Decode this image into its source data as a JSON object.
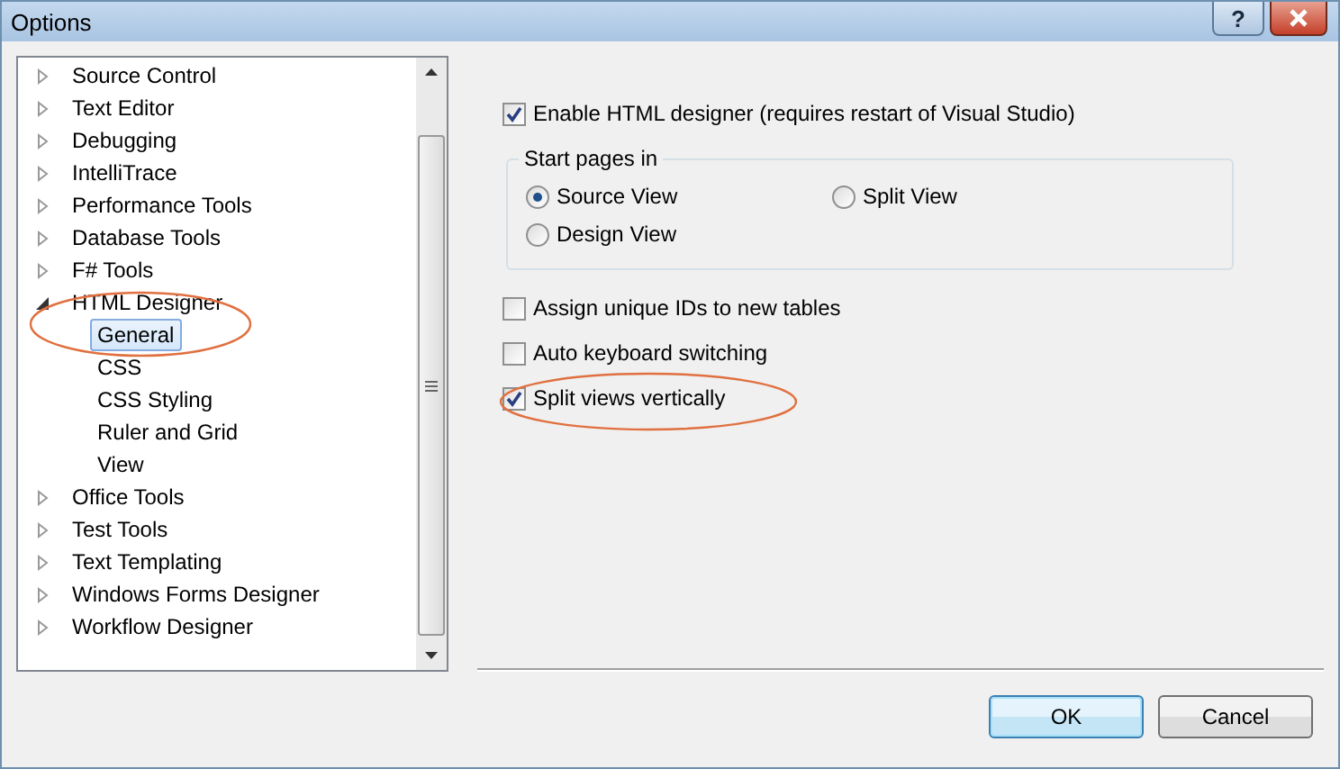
{
  "window": {
    "title": "Options",
    "help_button": "?"
  },
  "tree": [
    {
      "label": "Source Control",
      "expanded": false
    },
    {
      "label": "Text Editor",
      "expanded": false
    },
    {
      "label": "Debugging",
      "expanded": false
    },
    {
      "label": "IntelliTrace",
      "expanded": false
    },
    {
      "label": "Performance Tools",
      "expanded": false
    },
    {
      "label": "Database Tools",
      "expanded": false
    },
    {
      "label": "F# Tools",
      "expanded": false
    },
    {
      "label": "HTML Designer",
      "expanded": true,
      "children": [
        {
          "label": "General",
          "selected": true
        },
        {
          "label": "CSS",
          "selected": false
        },
        {
          "label": "CSS Styling",
          "selected": false
        },
        {
          "label": "Ruler and Grid",
          "selected": false
        },
        {
          "label": "View",
          "selected": false
        }
      ]
    },
    {
      "label": "Office Tools",
      "expanded": false
    },
    {
      "label": "Test Tools",
      "expanded": false
    },
    {
      "label": "Text Templating",
      "expanded": false
    },
    {
      "label": "Windows Forms Designer",
      "expanded": false
    },
    {
      "label": "Workflow Designer",
      "expanded": false
    }
  ],
  "enable_designer": {
    "label": "Enable HTML designer (requires restart of Visual Studio)",
    "checked": true
  },
  "start_pages": {
    "legend": "Start pages in",
    "options": [
      {
        "label": "Source View",
        "selected": true
      },
      {
        "label": "Split View",
        "selected": false
      },
      {
        "label": "Design View",
        "selected": false
      }
    ]
  },
  "options": [
    {
      "label": "Assign unique IDs to new tables",
      "checked": false
    },
    {
      "label": "Auto keyboard switching",
      "checked": false
    },
    {
      "label": "Split views vertically",
      "checked": true
    }
  ],
  "buttons": [
    {
      "label": "OK",
      "default": true
    },
    {
      "label": "Cancel",
      "default": false
    }
  ]
}
